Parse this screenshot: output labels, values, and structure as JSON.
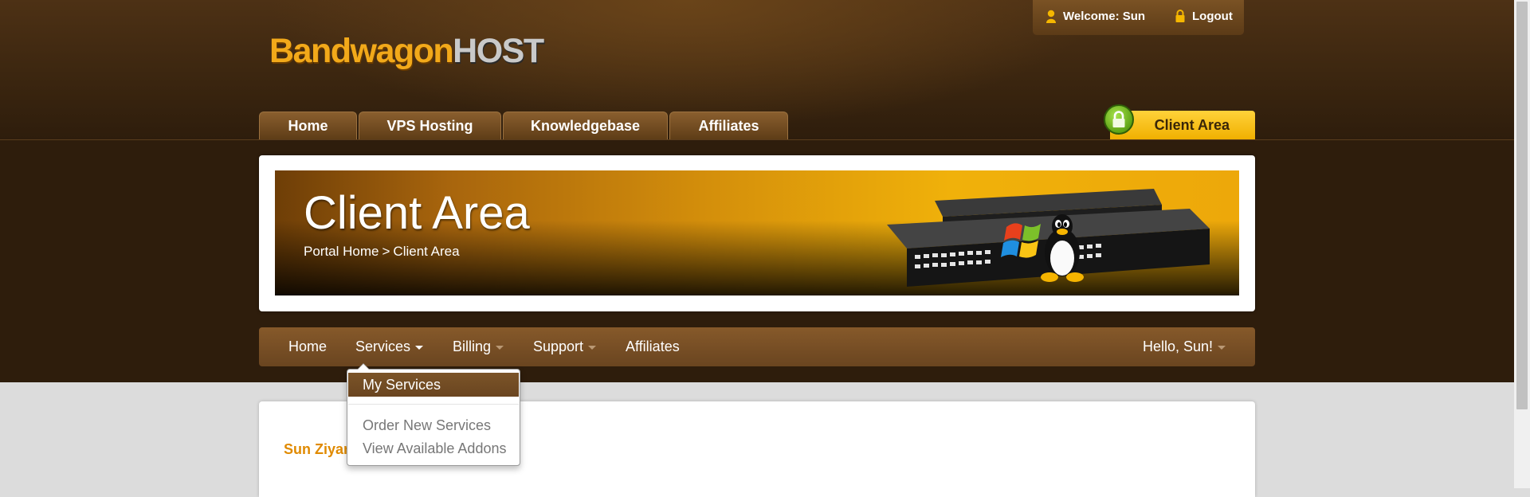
{
  "logo": {
    "part1": "Bandwagon",
    "part2": "HOST"
  },
  "userbox": {
    "welcome": "Welcome: Sun",
    "logout": "Logout"
  },
  "top_tabs": [
    "Home",
    "VPS Hosting",
    "Knowledgebase",
    "Affiliates"
  ],
  "client_area_tab": "Client Area",
  "banner": {
    "title": "Client Area",
    "breadcrumb": {
      "home": "Portal Home",
      "separator": ">",
      "current": "Client Area"
    }
  },
  "nav": {
    "items": [
      "Home",
      "Services",
      "Billing",
      "Support",
      "Affiliates"
    ],
    "user": "Hello, Sun!"
  },
  "services_dropdown": {
    "active": "My Services",
    "items": [
      "Order New Services",
      "View Available Addons"
    ]
  },
  "content": {
    "name": "Sun Ziyan"
  },
  "colors": {
    "accent": "#f0b000",
    "brown": "#6a4520",
    "name_orange": "#e08a00"
  }
}
